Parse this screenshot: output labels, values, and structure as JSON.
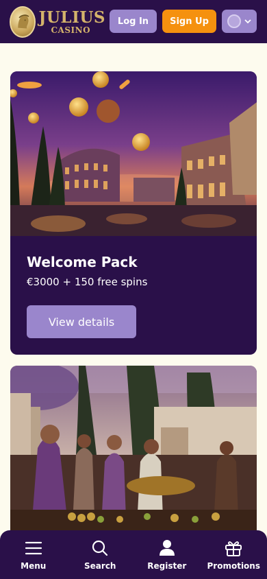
{
  "header": {
    "logo": {
      "title": "JULIUS",
      "subtitle": "CASINO",
      "icon": "caesar-coin-icon"
    },
    "login_label": "Log In",
    "signup_label": "Sign Up",
    "language": {
      "icon": "globe-icon",
      "dropdown_icon": "chevron-down-icon"
    }
  },
  "promotions": [
    {
      "title": "Welcome Pack",
      "subtitle": "€3000 + 150 free spins",
      "button_label": "View details"
    }
  ],
  "bottom_nav": [
    {
      "label": "Menu",
      "icon": "menu-icon"
    },
    {
      "label": "Search",
      "icon": "search-icon"
    },
    {
      "label": "Register",
      "icon": "user-icon"
    },
    {
      "label": "Promotions",
      "icon": "gift-icon"
    }
  ],
  "colors": {
    "header_bg": "#2a1049",
    "page_bg": "#fdfbee",
    "accent_purple": "#9a86cc",
    "accent_orange": "#f5910f",
    "gold": "#d4b36b"
  }
}
